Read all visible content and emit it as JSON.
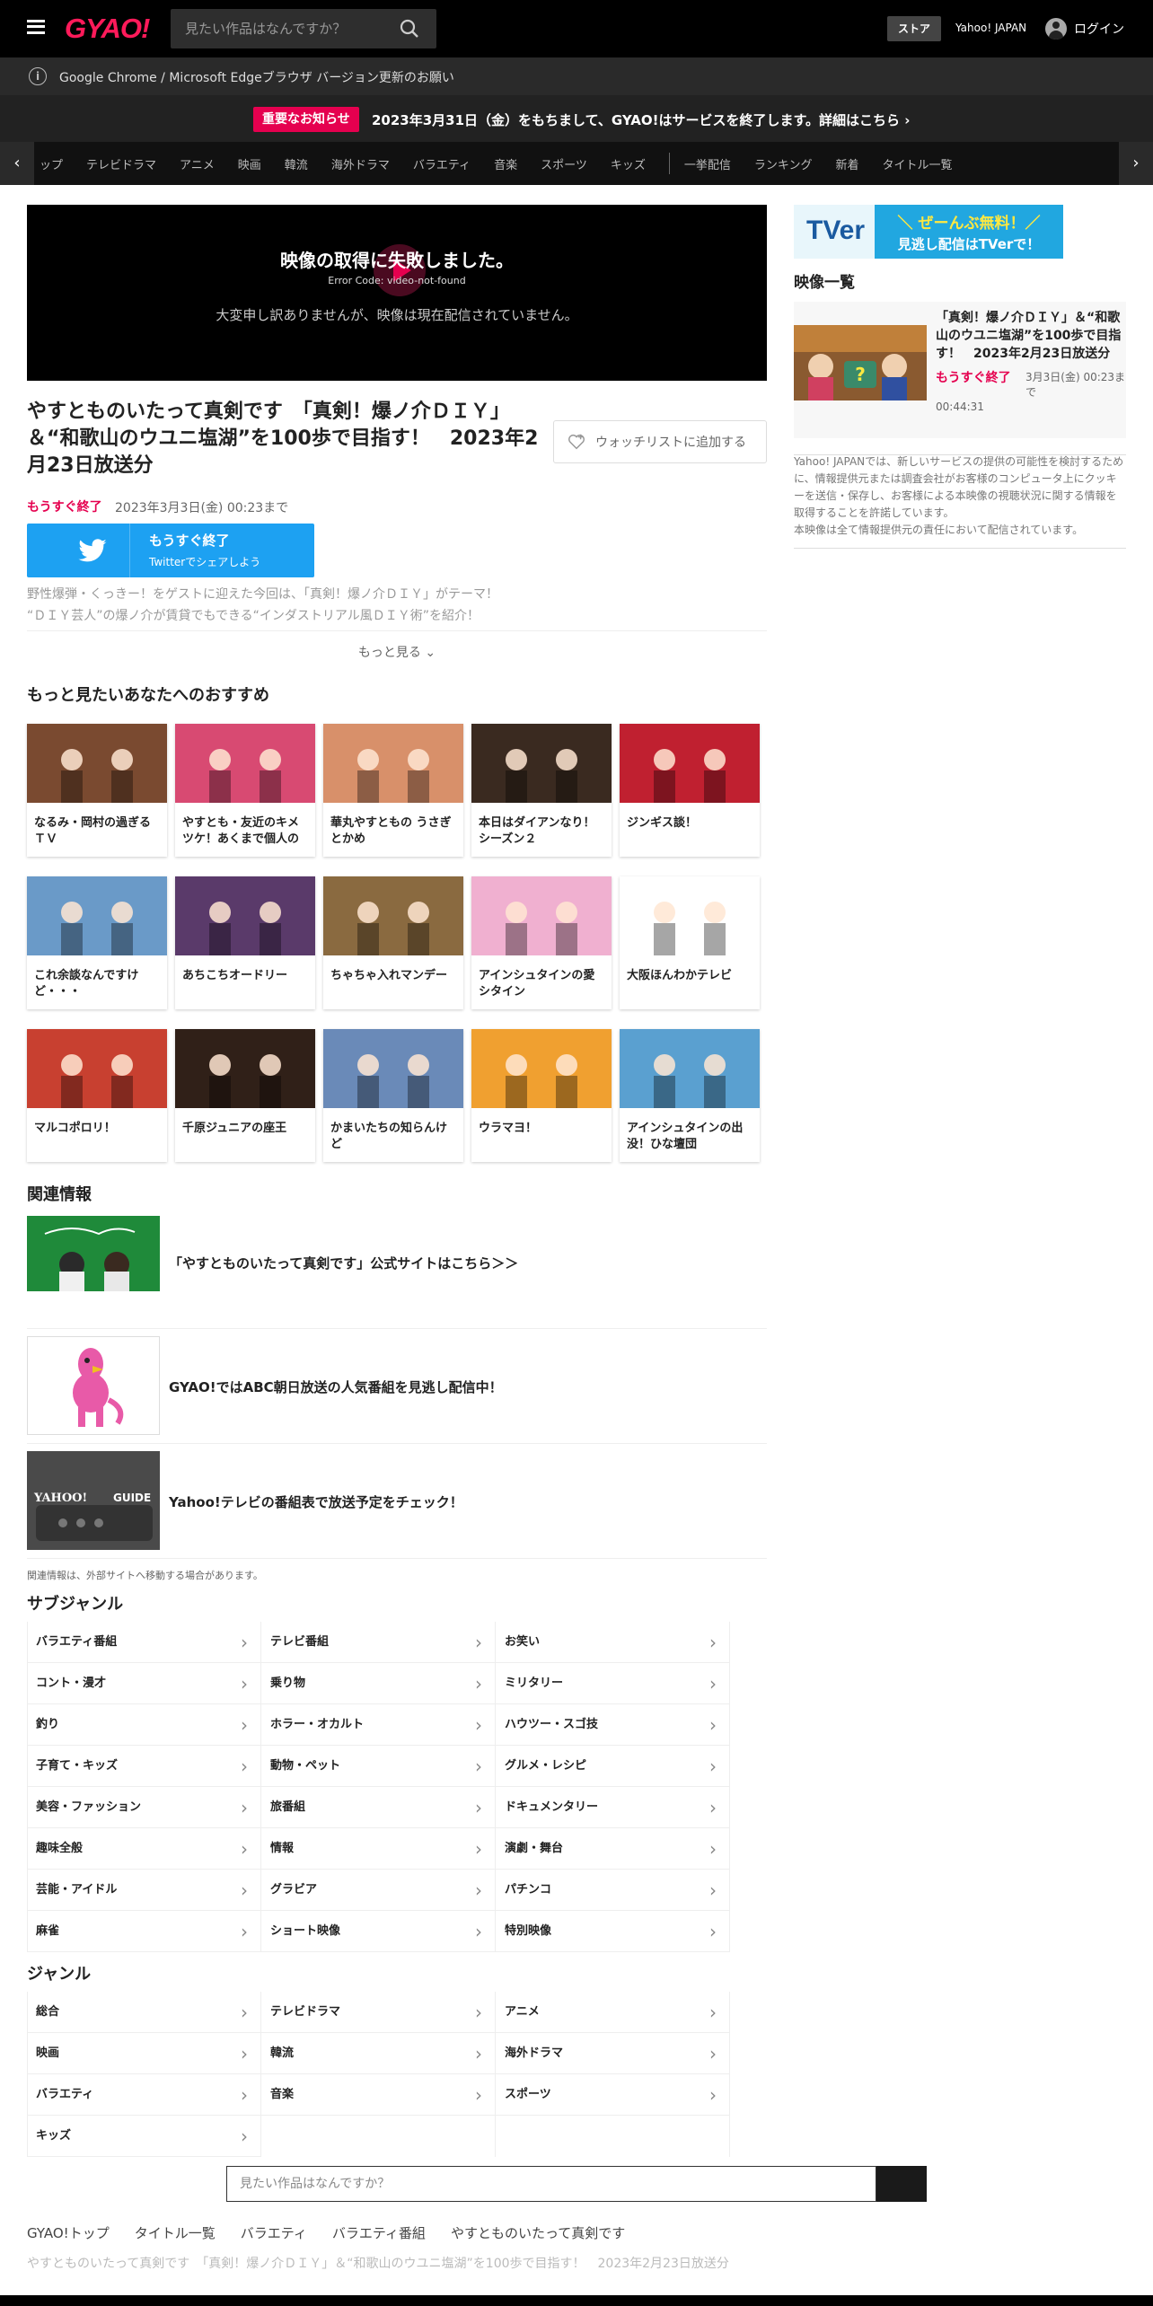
{
  "header": {
    "logo": "GYAO!",
    "search_placeholder": "見たい作品はなんですか？",
    "store": "ストア",
    "yahoo_japan": "Yahoo! JAPAN",
    "login": "ログイン"
  },
  "notices": {
    "browser": "Google Chrome / Microsoft Edgeブラウザ バージョン更新のお願い",
    "important_badge": "重要なお知らせ",
    "important_text": "2023年3月31日（金）をもちまして、GYAO!はサービスを終了します。詳細はこちら ›"
  },
  "nav": {
    "items": [
      "ップ",
      "テレビドラマ",
      "アニメ",
      "映画",
      "韓流",
      "海外ドラマ",
      "バラエティ",
      "音楽",
      "スポーツ",
      "キッズ"
    ],
    "items2": [
      "一挙配信",
      "ランキング",
      "新着",
      "タイトル一覧"
    ],
    "left_arrow": "‹",
    "right_arrow": "›"
  },
  "player": {
    "error_title": "映像の取得に失敗しました。",
    "error_code": "Error Code: video-not-found",
    "message": "大変申し訳ありませんが、映像は現在配信されていません。"
  },
  "video": {
    "title": "やすとものいたって真剣です　「真剣！爆ノ介ＤＩＹ」＆“和歌山のウユニ塩湖”を100歩で目指す！　2023年2月23日放送分",
    "watchlist": "ウォッチリストに追加する",
    "ending_soon": "もうすぐ終了",
    "until": "2023年3月3日(金) 00:23まで",
    "tw_line1": "もうすぐ終了",
    "tw_line2": "Twitterでシェアしよう",
    "desc1": "野性爆弾・くっきー！をゲストに迎えた今回は、「真剣！爆ノ介ＤＩＹ」がテーマ！",
    "desc2": "“ＤＩＹ芸人”の爆ノ介が賃貸でもできる“インダストリアル風ＤＩＹ術”を紹介！",
    "more": "もっと見る ⌄"
  },
  "recommend": {
    "heading": "もっと見たいあなたへのおすすめ",
    "items": [
      {
        "label": "なるみ・岡村の過ぎるＴＶ",
        "color": "#7a4a30"
      },
      {
        "label": "やすとも・友近のキメツケ！あくまで個人の",
        "color": "#d84a72"
      },
      {
        "label": "華丸やすともの うさぎとかめ",
        "color": "#d8906a"
      },
      {
        "label": "本日はダイアンなり！シーズン２",
        "color": "#3a2a20"
      },
      {
        "label": "ジンギス談！",
        "color": "#c02030"
      },
      {
        "label": "これ余談なんですけど・・・",
        "color": "#6a9ac8"
      },
      {
        "label": "あちこちオードリー",
        "color": "#5a3a6a"
      },
      {
        "label": "ちゃちゃ入れマンデー",
        "color": "#8a6a40"
      },
      {
        "label": "アインシュタインの愛シタイン",
        "color": "#f0b0d0"
      },
      {
        "label": "大阪ほんわかテレビ",
        "color": "#ffffff"
      },
      {
        "label": "マルコポロリ！",
        "color": "#c84030"
      },
      {
        "label": "千原ジュニアの座王",
        "color": "#302018"
      },
      {
        "label": "かまいたちの知らんけど",
        "color": "#6a8ab8"
      },
      {
        "label": "ウラマヨ！",
        "color": "#f0a030"
      },
      {
        "label": "アインシュタインの出没！ひな壇団",
        "color": "#5aa0d0"
      }
    ]
  },
  "related": {
    "heading": "関連情報",
    "items": [
      {
        "label": "「やすとものいたって真剣です」公式サイトはこちら＞＞"
      },
      {
        "label": "GYAO!ではABC朝日放送の人気番組を見逃し配信中！"
      },
      {
        "label": "Yahoo!テレビの番組表で放送予定をチェック！"
      }
    ],
    "note": "関連情報は、外部サイトへ移動する場合があります。"
  },
  "subgenre": {
    "heading": "サブジャンル",
    "items": [
      "バラエティ番組",
      "テレビ番組",
      "お笑い",
      "コント・漫才",
      "乗り物",
      "ミリタリー",
      "釣り",
      "ホラー・オカルト",
      "ハウツー・スゴ技",
      "子育て・キッズ",
      "動物・ペット",
      "グルメ・レシピ",
      "美容・ファッション",
      "旅番組",
      "ドキュメンタリー",
      "趣味全般",
      "情報",
      "演劇・舞台",
      "芸能・アイドル",
      "グラビア",
      "パチンコ",
      "麻雀",
      "ショート映像",
      "特別映像"
    ]
  },
  "genre": {
    "heading": "ジャンル",
    "items": [
      "総合",
      "テレビドラマ",
      "アニメ",
      "映画",
      "韓流",
      "海外ドラマ",
      "バラエティ",
      "音楽",
      "スポーツ",
      "キッズ"
    ]
  },
  "footer": {
    "search_placeholder": "見たい作品はなんですか？",
    "breadcrumb": [
      "GYAO!トップ",
      "タイトル一覧",
      "バラエティ",
      "バラエティ番組",
      "やすとものいたって真剣です"
    ],
    "current": "やすとものいたって真剣です　「真剣！爆ノ介ＤＩＹ」＆“和歌山のウユニ塩湖”を100歩で目指す！　2023年2月23日放送分"
  },
  "sidebar": {
    "tver_logo": "TVer",
    "tver_line1": "＼ ぜーんぶ無料！／",
    "tver_line2": "見逃し配信はTVerで！",
    "heading": "映像一覧",
    "card_title": "「真剣！爆ノ介ＤＩＹ」＆“和歌山のウユニ塩湖”を100歩で目指す！　2023年2月23日放送分",
    "card_ending": "もうすぐ終了",
    "card_until": "3月3日(金) 00:23まで",
    "card_duration": "00:44:31",
    "text1": "Yahoo! JAPANでは、新しいサービスの提供の可能性を検討するために、情報提供元または調査会社がお客様のコンピュータ上にクッキーを送信・保存し、お客様による本映像の視聴状況に関する情報を取得することを許諾しています。",
    "text2": "本映像は全て情報提供元の責任において配信されています。"
  }
}
